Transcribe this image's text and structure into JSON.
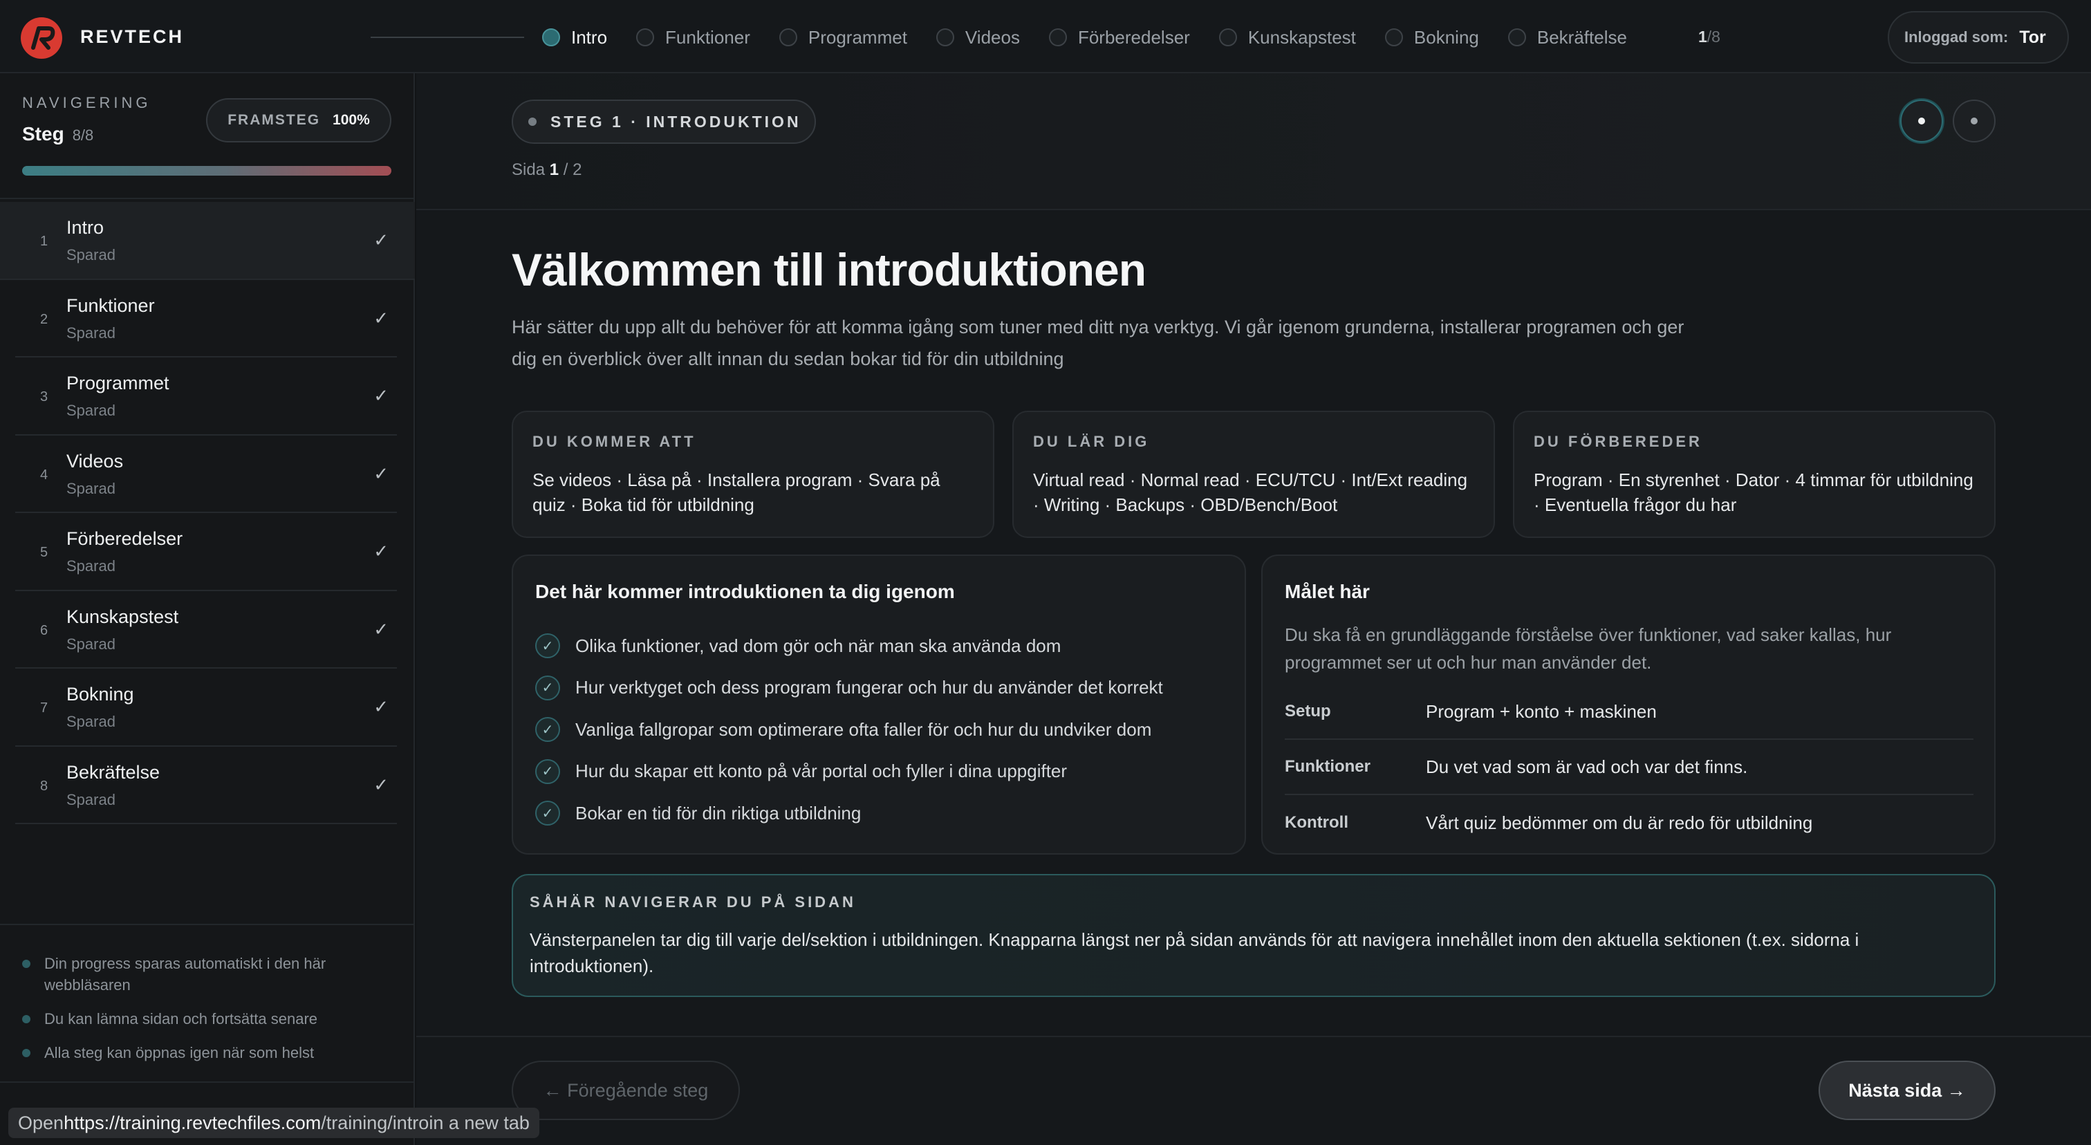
{
  "brand": {
    "name": "REVTECH",
    "logo_icon": "revtech-r-logo",
    "logo_color": "#d93a31"
  },
  "header": {
    "steps": [
      {
        "label": "Intro",
        "active": true
      },
      {
        "label": "Funktioner"
      },
      {
        "label": "Programmet"
      },
      {
        "label": "Videos"
      },
      {
        "label": "Förberedelser"
      },
      {
        "label": "Kunskapstest"
      },
      {
        "label": "Bokning"
      },
      {
        "label": "Bekräftelse"
      }
    ],
    "counter_current": "1",
    "counter_total": "/8",
    "user_label": "Inloggad som:",
    "user_name": "Tor"
  },
  "sidebar": {
    "nav_label": "NAVIGERING",
    "steg_label": "Steg",
    "steg_count": "8/8",
    "progress_label": "FRAMSTEG",
    "progress_value": "100%",
    "progress_fraction": 1.0,
    "items": [
      {
        "num": "1",
        "title": "Intro",
        "status": "Sparad"
      },
      {
        "num": "2",
        "title": "Funktioner",
        "status": "Sparad"
      },
      {
        "num": "3",
        "title": "Programmet",
        "status": "Sparad"
      },
      {
        "num": "4",
        "title": "Videos",
        "status": "Sparad"
      },
      {
        "num": "5",
        "title": "Förberedelser",
        "status": "Sparad"
      },
      {
        "num": "6",
        "title": "Kunskapstest",
        "status": "Sparad"
      },
      {
        "num": "7",
        "title": "Bokning",
        "status": "Sparad"
      },
      {
        "num": "8",
        "title": "Bekräftelse",
        "status": "Sparad"
      }
    ],
    "check_glyph": "✓",
    "notes": [
      "Din progress sparas automatiskt i den här webbläsaren",
      "Du kan lämna sidan och fortsätta senare",
      "Alla steg kan öppnas igen när som helst"
    ]
  },
  "main": {
    "badge": "STEG 1 · INTRODUKTION",
    "page_label": "Sida",
    "page_current": "1",
    "page_total": " / 2",
    "title": "Välkommen till introduktionen",
    "lead": "Här sätter du upp allt du behöver för att komma igång som tuner med ditt nya verktyg. Vi går igenom grunderna, installerar programen och ger dig en överblick över allt innan du sedan bokar tid för din utbildning",
    "cards": [
      {
        "title": "DU KOMMER ATT",
        "body": "Se videos · Läsa på · Installera program · Svara på quiz · Boka tid för utbildning"
      },
      {
        "title": "DU LÄR DIG",
        "body": "Virtual read · Normal read · ECU/TCU · Int/Ext reading · Writing · Backups · OBD/Bench/Boot"
      },
      {
        "title": "DU FÖRBEREDER",
        "body": "Program · En styrenhet · Dator · 4 timmar för utbildning · Eventuella frågor du har"
      }
    ],
    "checklist": {
      "title": "Det här kommer introduktionen ta dig igenom",
      "items": [
        "Olika funktioner, vad dom gör och när man ska använda dom",
        "Hur verktyget och dess program fungerar och hur du använder det korrekt",
        "Vanliga fallgropar som optimerare ofta faller för och hur du undviker dom",
        "Hur du skapar ett konto på vår portal och fyller i dina uppgifter",
        "Bokar en tid för din riktiga utbildning"
      ]
    },
    "goal": {
      "title": "Målet här",
      "text": "Du ska få en grundläggande förståelse över funktioner, vad saker kallas, hur programmet ser ut och hur man använder det.",
      "rows": [
        {
          "key": "Setup",
          "value": "Program + konto + maskinen"
        },
        {
          "key": "Funktioner",
          "value": "Du vet vad som är vad och var det finns."
        },
        {
          "key": "Kontroll",
          "value": "Vårt quiz bedömmer om du är redo för utbildning"
        }
      ]
    },
    "navhelp": {
      "title": "SÅHÄR NAVIGERAR DU PÅ SIDAN",
      "body": "Vänsterpanelen tar dig till varje del/sektion i utbildningen. Knapparna längst ner på sidan används för att navigera innehållet inom den aktuella sektionen (t.ex. sidorna i introduktionen)."
    },
    "prev_button": "← Föregående steg",
    "next_button": "Nästa sida  →"
  },
  "statusbar": {
    "prefix": "Open ",
    "url": "https://training.revtechfiles.com",
    "path": "/training/intro",
    "suffix": " in a new tab"
  }
}
